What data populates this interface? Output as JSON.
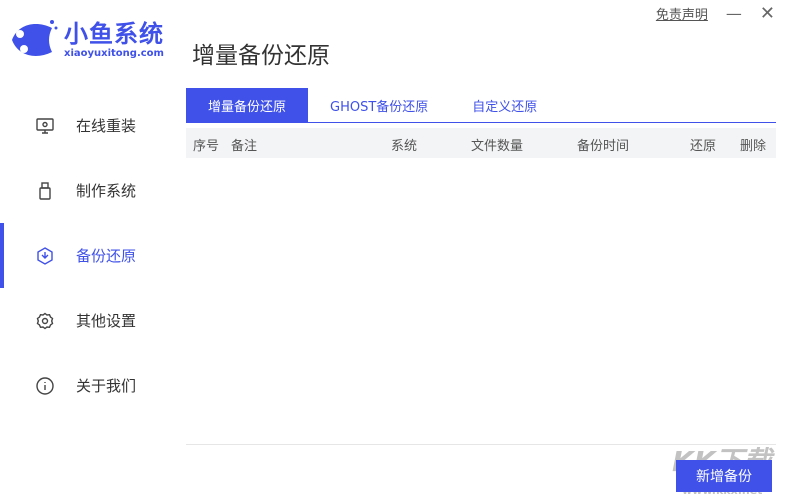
{
  "logo": {
    "cn": "小鱼系统",
    "en": "xiaoyuxitong.com"
  },
  "page_title": "增量备份还原",
  "topbar": {
    "disclaimer": "免责声明",
    "minimize": "—",
    "close": "✕"
  },
  "sidebar": {
    "items": [
      {
        "label": "在线重装",
        "icon": "monitor-icon"
      },
      {
        "label": "制作系统",
        "icon": "usb-icon"
      },
      {
        "label": "备份还原",
        "icon": "backup-icon",
        "active": true
      },
      {
        "label": "其他设置",
        "icon": "gear-icon"
      },
      {
        "label": "关于我们",
        "icon": "info-icon"
      }
    ]
  },
  "tabs": [
    {
      "label": "增量备份还原",
      "active": true
    },
    {
      "label": "GHOST备份还原"
    },
    {
      "label": "自定义还原"
    }
  ],
  "table": {
    "columns": [
      "序号",
      "备注",
      "系统",
      "文件数量",
      "备份时间",
      "还原",
      "删除"
    ],
    "rows": []
  },
  "new_backup_label": "新增备份",
  "watermark": {
    "main": "KK下载",
    "url": "www.kkx.net"
  },
  "colors": {
    "accent": "#3f51e8"
  }
}
